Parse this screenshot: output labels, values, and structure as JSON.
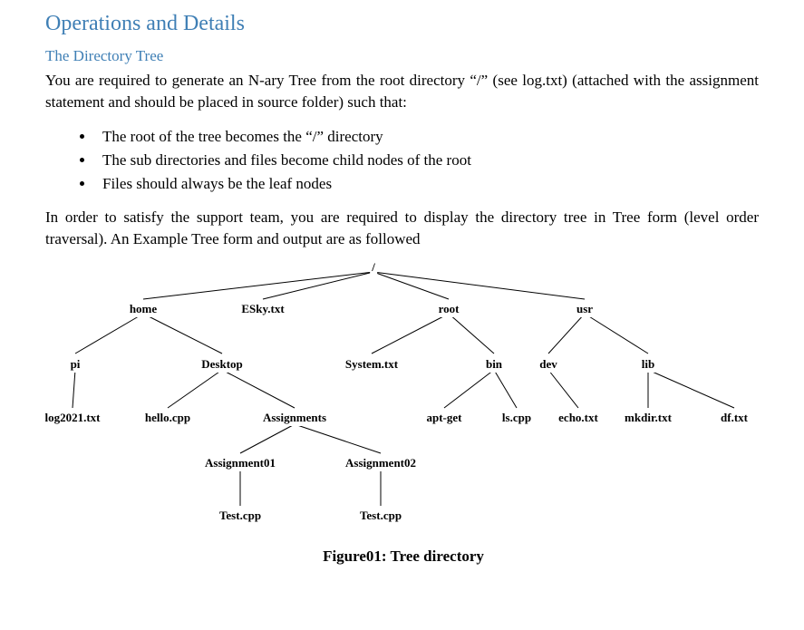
{
  "heading1": "Operations and Details",
  "heading2": "The Directory Tree",
  "para1": "You are required to generate an N-ary Tree from the root directory “/” (see log.txt) (attached with the assignment statement and should be placed in source folder) such that:",
  "bullets": {
    "b0": "The root of the tree becomes the “/” directory",
    "b1": "The sub directories and files become child nodes of the root",
    "b2": "Files should always be the leaf nodes"
  },
  "para2": "In order to satisfy the support team, you are required to display the directory tree in Tree form (level order traversal). An Example Tree form and output are as followed",
  "tree": {
    "slash": "/",
    "home": "home",
    "esky": "ESky.txt",
    "root": "root",
    "usr": "usr",
    "pi": "pi",
    "desktop": "Desktop",
    "systemtxt": "System.txt",
    "bin": "bin",
    "dev": "dev",
    "lib": "lib",
    "log2021": "log2021.txt",
    "hellocpp": "hello.cpp",
    "assignments": "Assignments",
    "aptget": "apt-get",
    "lscpp": "ls.cpp",
    "echotxt": "echo.txt",
    "mkdirtxt": "mkdir.txt",
    "dftxt": "df.txt",
    "assignment01": "Assignment01",
    "assignment02": "Assignment02",
    "testcpp1": "Test.cpp",
    "testcpp2": "Test.cpp"
  },
  "caption": "Figure01: Tree directory"
}
